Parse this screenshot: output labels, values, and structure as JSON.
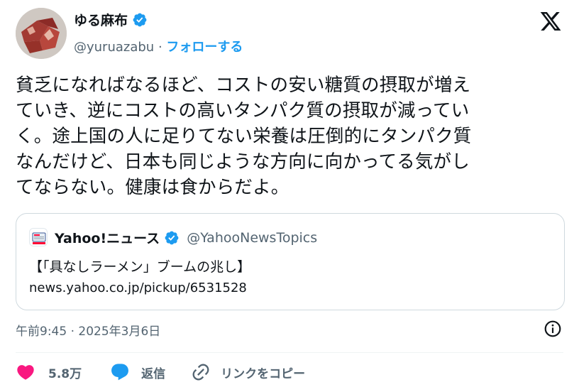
{
  "author": {
    "display_name": "ゆる麻布",
    "handle": "@yuruazabu",
    "separator": "·",
    "follow_label": "フォローする"
  },
  "tweet": {
    "lines": [
      "貧乏になればなるほど、コストの安い糖質の摂取が増え",
      "ていき、逆にコストの高いタンパク質の摂取が減ってい",
      "く。途上国の人に足りてない栄養は圧倒的にタンパク質",
      "なんだけど、日本も同じような方向に向かってる気がし",
      "てならない。健康は食からだよ。"
    ]
  },
  "quote": {
    "name": "Yahoo!ニュース",
    "handle": "@YahooNewsTopics",
    "title": "【「具なしラーメン」ブームの兆し】",
    "link": "news.yahoo.co.jp/pickup/6531528"
  },
  "meta": {
    "timestamp": "午前9:45 · 2025年3月6日"
  },
  "actions": {
    "like_count": "5.8万",
    "reply_label": "返信",
    "copy_link_label": "リンクをコピー"
  },
  "colors": {
    "accent": "#1d9bf0",
    "like": "#f91880",
    "muted": "#536471"
  }
}
